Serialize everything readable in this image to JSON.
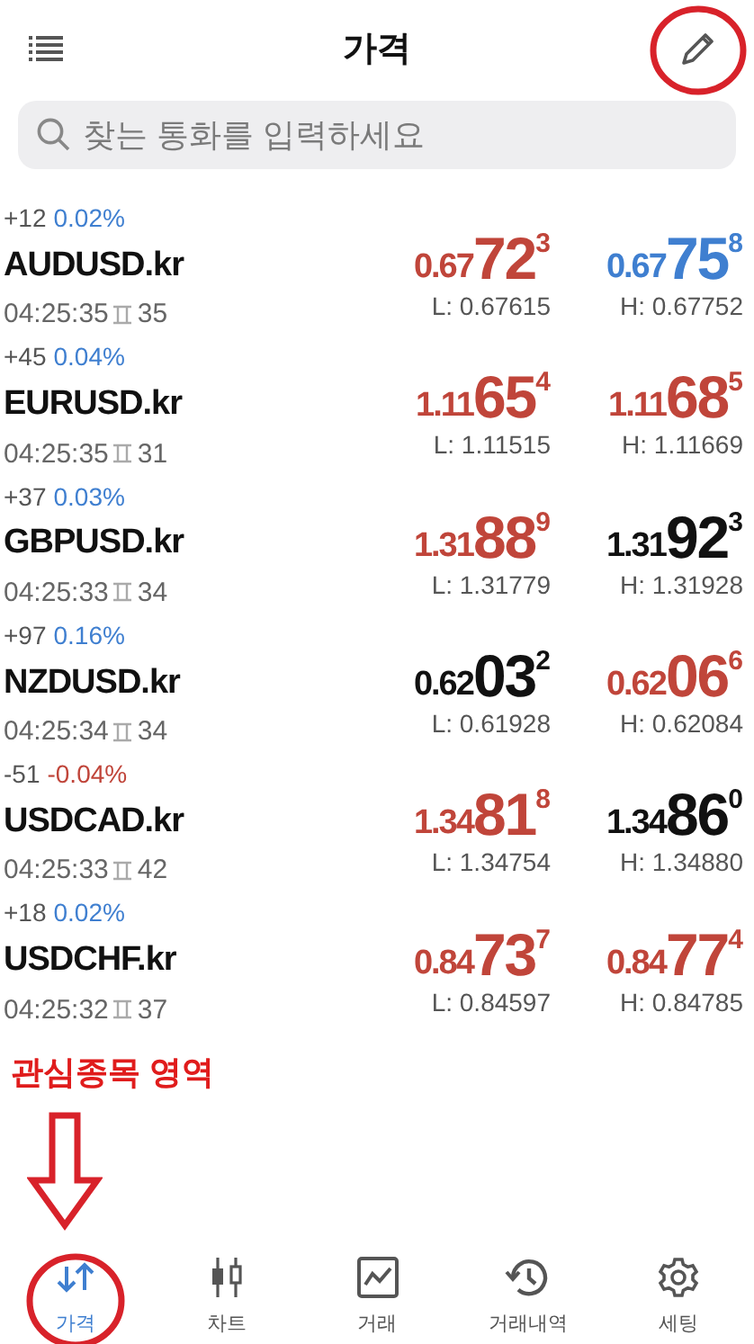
{
  "header": {
    "title": "가격"
  },
  "search": {
    "placeholder": "찾는 통화를 입력하세요"
  },
  "quotes": [
    {
      "change_points": "+12",
      "change_pct": "0.02%",
      "color": "#3f7fd0",
      "symbol": "AUDUSD.kr",
      "time": "04:25:35",
      "spread": "35",
      "bid": {
        "prefix": "0.67",
        "big": "72",
        "sup": "3",
        "color": "#c0453a"
      },
      "low": "L: 0.67615",
      "ask": {
        "prefix": "0.67",
        "big": "75",
        "sup": "8",
        "color": "#3f7fd0"
      },
      "high": "H: 0.67752"
    },
    {
      "change_points": "+45",
      "change_pct": "0.04%",
      "color": "#3f7fd0",
      "symbol": "EURUSD.kr",
      "time": "04:25:35",
      "spread": "31",
      "bid": {
        "prefix": "1.11",
        "big": "65",
        "sup": "4",
        "color": "#c0453a"
      },
      "low": "L: 1.11515",
      "ask": {
        "prefix": "1.11",
        "big": "68",
        "sup": "5",
        "color": "#c0453a"
      },
      "high": "H: 1.11669"
    },
    {
      "change_points": "+37",
      "change_pct": "0.03%",
      "color": "#3f7fd0",
      "symbol": "GBPUSD.kr",
      "time": "04:25:33",
      "spread": "34",
      "bid": {
        "prefix": "1.31",
        "big": "88",
        "sup": "9",
        "color": "#c0453a"
      },
      "low": "L: 1.31779",
      "ask": {
        "prefix": "1.31",
        "big": "92",
        "sup": "3",
        "color": "#111111"
      },
      "high": "H: 1.31928"
    },
    {
      "change_points": "+97",
      "change_pct": "0.16%",
      "color": "#3f7fd0",
      "symbol": "NZDUSD.kr",
      "time": "04:25:34",
      "spread": "34",
      "bid": {
        "prefix": "0.62",
        "big": "03",
        "sup": "2",
        "color": "#111111"
      },
      "low": "L: 0.61928",
      "ask": {
        "prefix": "0.62",
        "big": "06",
        "sup": "6",
        "color": "#c0453a"
      },
      "high": "H: 0.62084"
    },
    {
      "change_points": "-51",
      "change_pct": "-0.04%",
      "color": "#c0453a",
      "symbol": "USDCAD.kr",
      "time": "04:25:33",
      "spread": "42",
      "bid": {
        "prefix": "1.34",
        "big": "81",
        "sup": "8",
        "color": "#c0453a"
      },
      "low": "L: 1.34754",
      "ask": {
        "prefix": "1.34",
        "big": "86",
        "sup": "0",
        "color": "#111111"
      },
      "high": "H: 1.34880"
    },
    {
      "change_points": "+18",
      "change_pct": "0.02%",
      "color": "#3f7fd0",
      "symbol": "USDCHF.kr",
      "time": "04:25:32",
      "spread": "37",
      "bid": {
        "prefix": "0.84",
        "big": "73",
        "sup": "7",
        "color": "#c0453a"
      },
      "low": "L: 0.84597",
      "ask": {
        "prefix": "0.84",
        "big": "77",
        "sup": "4",
        "color": "#c0453a"
      },
      "high": "H: 0.84785"
    }
  ],
  "annotation": {
    "label": "관심종목 영역"
  },
  "tabs": [
    {
      "kind": "quotes",
      "label": "가격",
      "selected": true
    },
    {
      "kind": "chart",
      "label": "차트",
      "selected": false
    },
    {
      "kind": "trade",
      "label": "거래",
      "selected": false
    },
    {
      "kind": "history",
      "label": "거래내역",
      "selected": false
    },
    {
      "kind": "settings",
      "label": "세팅",
      "selected": false
    }
  ]
}
